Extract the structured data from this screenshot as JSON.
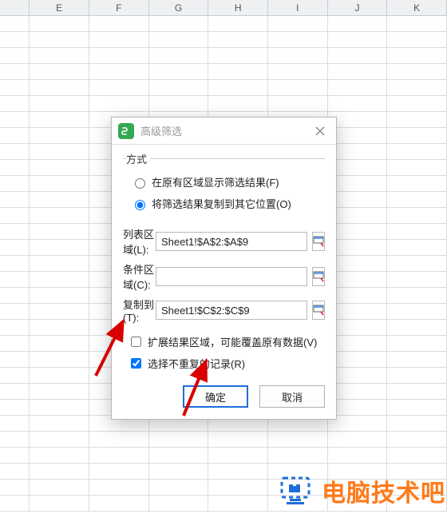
{
  "columns": [
    "E",
    "F",
    "G",
    "H",
    "I",
    "J",
    "K"
  ],
  "dialog": {
    "title": "高级筛选",
    "group_label": "方式",
    "radio_inplace": "在原有区域显示筛选结果(F)",
    "radio_copy": "将筛选结果复制到其它位置(O)",
    "label_list": "列表区域(L):",
    "label_cond": "条件区域(C):",
    "label_copy": "复制到(T):",
    "value_list": "Sheet1!$A$2:$A$9",
    "value_cond": "",
    "value_copy": "Sheet1!$C$2:$C$9",
    "check_expand": "扩展结果区域，可能覆盖原有数据(V)",
    "check_unique": "选择不重复的记录(R)",
    "ok": "确定",
    "cancel": "取消"
  },
  "watermark": {
    "text": "电脑技术吧"
  }
}
